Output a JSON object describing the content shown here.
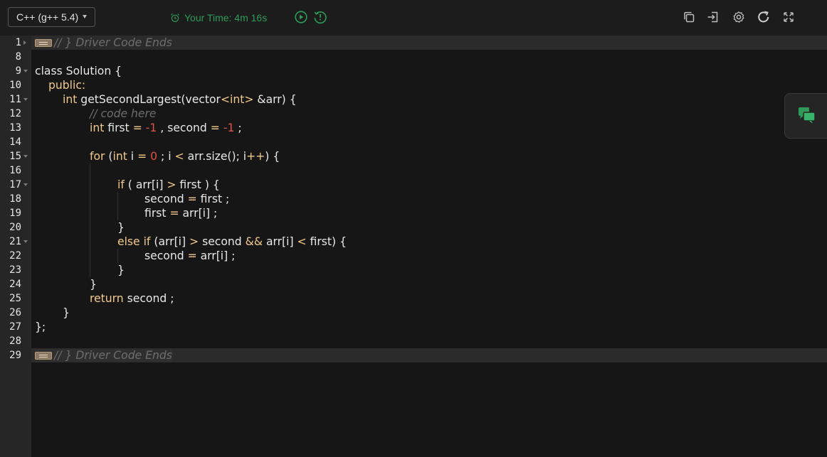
{
  "toolbar": {
    "language": "C++ (g++ 5.4)",
    "timer_label": "Your Time: 4m 16s",
    "icons": [
      "run-icon",
      "history-icon",
      "copy-icon",
      "import-icon",
      "settings-icon",
      "reset-icon",
      "fullscreen-icon"
    ]
  },
  "colors": {
    "timer": "#2e9b58",
    "keyword": "#f2c98c",
    "number": "#e0534a",
    "comment": "#6d6d6d",
    "chat_icon": "#2e9b58"
  },
  "editor": {
    "line_numbers": [
      "1",
      "8",
      "9",
      "10",
      "11",
      "12",
      "13",
      "14",
      "15",
      "16",
      "17",
      "18",
      "19",
      "20",
      "21",
      "22",
      "23",
      "24",
      "25",
      "26",
      "27",
      "28",
      "29"
    ],
    "lines": {
      "l1_comment": "// } Driver Code Ends",
      "l9_class": "class",
      "l9_rest": " Solution {",
      "l10": "public:",
      "l11_int": "int",
      "l11_fn": " getSecondLargest(vector",
      "l11_lt": "<",
      "l11_int2": "int",
      "l11_gt": ">",
      "l11_rest": " &arr) {",
      "l12_comment": "// code here",
      "l13_int": "int",
      "l13_a": " first ",
      "l13_eq": "=",
      "l13_sp": " ",
      "l13_n1": "-1",
      "l13_b": " , second ",
      "l13_eq2": "=",
      "l13_sp2": " ",
      "l13_n2": "-1",
      "l13_c": " ;",
      "l15_for": "for",
      "l15_a": " (",
      "l15_int": "int",
      "l15_b": " i ",
      "l15_eq": "=",
      "l15_sp": " ",
      "l15_n0": "0",
      "l15_c": " ; i ",
      "l15_lt": "<",
      "l15_d": " arr.size(); i",
      "l15_pp": "++",
      "l15_e": ") {",
      "l17_if": "if",
      "l17_a": " ( arr[i] ",
      "l17_gt": ">",
      "l17_b": " first ) {",
      "l18_a": "second ",
      "l18_eq": "=",
      "l18_b": " first ;",
      "l19_a": "first ",
      "l19_eq": "=",
      "l19_b": " arr[i] ;",
      "l20": "}",
      "l21_else": "else if",
      "l21_a": " (arr[i] ",
      "l21_gt": ">",
      "l21_b": " second ",
      "l21_and": "&&",
      "l21_c": " arr[i] ",
      "l21_lt": "<",
      "l21_d": " first) {",
      "l22_a": "second ",
      "l22_eq": "=",
      "l22_b": " arr[i] ;",
      "l23": "}",
      "l24": "}",
      "l25_ret": "return",
      "l25_rest": " second ;",
      "l26": "}",
      "l27": "};",
      "l29_comment": "// } Driver Code Ends"
    }
  }
}
